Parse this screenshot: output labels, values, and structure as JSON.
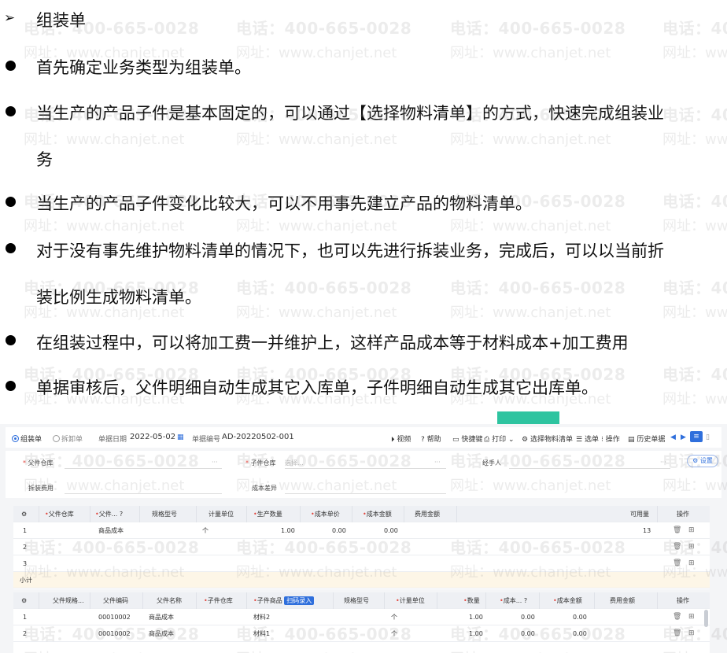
{
  "document": {
    "heading": "组装单",
    "bullets": [
      {
        "lines": [
          "首先确定业务类型为组装单。"
        ]
      },
      {
        "lines": [
          "当生产的产品子件是基本固定的，可以通过【选择物料清单】的方式，快速完成组装业",
          "务"
        ]
      },
      {
        "lines": [
          "当生产的产品子件变化比较大，可以不用事先建立产品的物料清单。"
        ]
      },
      {
        "lines": [
          "对于没有事先维护物料清单的情况下，也可以先进行拆装业务，完成后，可以以当前折",
          "装比例生成物料清单。"
        ]
      },
      {
        "lines": [
          "在组装过程中，可以将加工费一并维护上，这样产品成本等于材料成本+加工费用"
        ]
      },
      {
        "lines": [
          "单据审核后，父件明细自动生成其它入库单，子件明细自动生成其它出库单。"
        ]
      }
    ]
  },
  "watermark": {
    "phone": "电话：400-665-0028",
    "url": "网址：www.chanjet.net"
  },
  "screenshot": {
    "toolbar": {
      "radio_assemble": "组装单",
      "radio_disassemble": "拆卸单",
      "date_label": "单据日期",
      "date_value": "2022-05-02",
      "number_label": "单据编号",
      "number_value": "AD-20220502-001",
      "video": "视频",
      "help": "帮助",
      "shortcut": "快捷键",
      "print": "打印",
      "select_bom": "选择物料清单",
      "select_doc": "选单",
      "operate": "操作",
      "history": "历史单据"
    },
    "form": {
      "parent_warehouse_label": "父件仓库",
      "child_warehouse_label": "子件仓库",
      "child_warehouse_placeholder": "选择...",
      "handler_label": "经手人",
      "disassembly_fee_label": "拆装费用",
      "cost_diff_label": "成本差异",
      "settings": "设置"
    },
    "parent_grid": {
      "headers": [
        "父件仓库",
        "父件...",
        "规格型号",
        "计量单位",
        "生产数量",
        "成本单价",
        "成本金额",
        "费用金额",
        "可用量",
        "操作"
      ],
      "rows": [
        {
          "no": "1",
          "name": "商品成本",
          "unit": "个",
          "qty": "1.00",
          "price": "0.00",
          "amount": "0.00",
          "available": "13"
        },
        {
          "no": "2",
          "name": "",
          "unit": "",
          "qty": "",
          "price": "",
          "amount": "",
          "available": ""
        },
        {
          "no": "3",
          "name": "",
          "unit": "",
          "qty": "",
          "price": "",
          "amount": "",
          "available": ""
        }
      ],
      "subtotal": "小计"
    },
    "child_grid": {
      "headers": [
        "父件规格...",
        "父件编码",
        "父件名称",
        "子件仓库",
        "子件商品",
        "扫码录入",
        "规格型号",
        "计量单位",
        "数量",
        "成本...",
        "成本金额",
        "费用金额",
        "操作"
      ],
      "rows": [
        {
          "no": "1",
          "code": "00010002",
          "pname": "商品成本",
          "item": "材料2",
          "unit": "个",
          "qty": "1.00",
          "price": "0.00",
          "amount": "0.00"
        },
        {
          "no": "2",
          "code": "00010002",
          "pname": "商品成本",
          "item": "材料1",
          "unit": "个",
          "qty": "1.00",
          "price": "0.00",
          "amount": "0.00"
        }
      ]
    }
  }
}
